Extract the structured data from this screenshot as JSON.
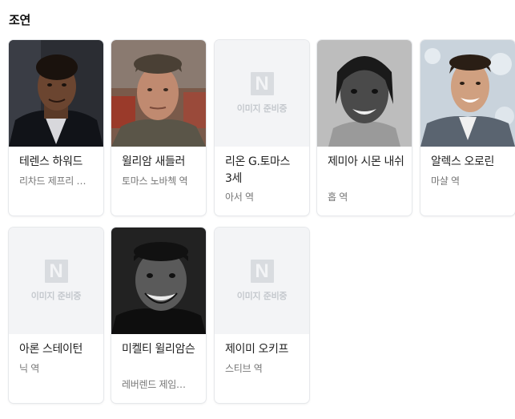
{
  "section": {
    "title": "조연"
  },
  "cast": [
    {
      "name": "테렌스 하워드",
      "role": "리차드 제프리 …",
      "photo": "photo"
    },
    {
      "name": "윌리암 새들러",
      "role": "토마스 노바첵 역",
      "photo": "photo"
    },
    {
      "name": "리온 G.토마스 3세",
      "role": "아서 역",
      "photo": "placeholder",
      "placeholder_text": "이미지 준비중"
    },
    {
      "name": "제미아 시몬 내쉬",
      "role": "홉 역",
      "photo": "photo"
    },
    {
      "name": "알렉스 오로린",
      "role": "마샬 역",
      "photo": "photo"
    },
    {
      "name": "아론 스테이턴",
      "role": "닉 역",
      "photo": "placeholder",
      "placeholder_text": "이미지 준비중"
    },
    {
      "name": "미켈티 윌리암슨",
      "role": "레버렌드 제임…",
      "photo": "photo"
    },
    {
      "name": "제이미 오키프",
      "role": "스티브 역",
      "photo": "placeholder",
      "placeholder_text": "이미지 준비중"
    }
  ],
  "placeholder_logo": "N"
}
